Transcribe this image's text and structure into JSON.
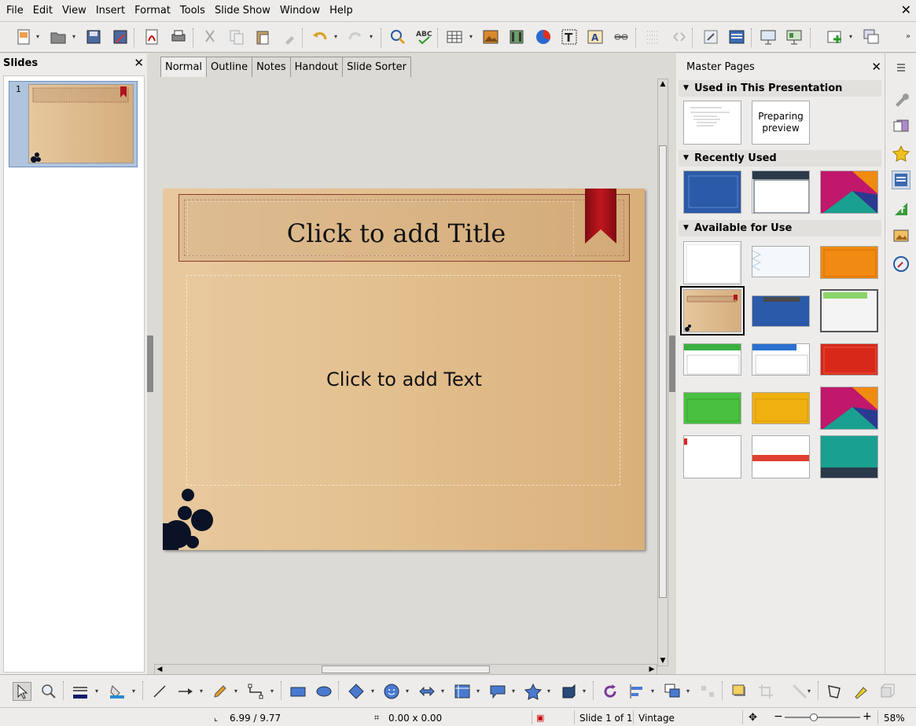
{
  "menubar": {
    "items": [
      "File",
      "Edit",
      "View",
      "Insert",
      "Format",
      "Tools",
      "Slide Show",
      "Window",
      "Help"
    ]
  },
  "slides_panel": {
    "title": "Slides",
    "slides": [
      {
        "number": "1"
      }
    ]
  },
  "view_tabs": [
    "Normal",
    "Outline",
    "Notes",
    "Handout",
    "Slide Sorter"
  ],
  "active_tab": "Normal",
  "slide": {
    "title_placeholder": "Click to add Title",
    "text_placeholder": "Click to add Text"
  },
  "master_pages": {
    "title": "Master Pages",
    "sections": {
      "used": "Used in This Presentation",
      "recent": "Recently Used",
      "available": "Available for Use"
    },
    "preparing_preview": "Preparing preview"
  },
  "statusbar": {
    "position": "6.99 / 9.77",
    "size": "0.00 x 0.00",
    "slide_info": "Slide 1 of 1",
    "master_name": "Vintage",
    "zoom": "58%",
    "zoom_level": 0.58
  },
  "colors": {
    "slide_bg_left": "#e8c99e",
    "slide_bg_right": "#d9b07a",
    "ribbon": "#b0141c",
    "ink": "#0b1226",
    "selected_thumb": "#b0c4de"
  }
}
